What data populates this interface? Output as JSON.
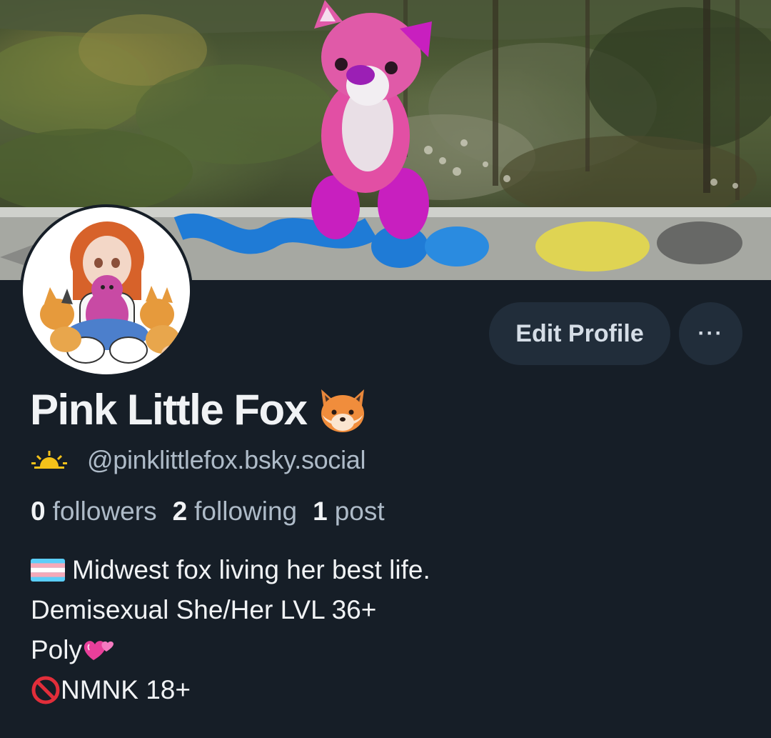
{
  "profile": {
    "display_name": "Pink Little Fox",
    "handle": "@pinklittlefox.bsky.social",
    "display_name_emoji": "fox-face-emoji",
    "handle_badge_icon": "sunrise-icon"
  },
  "actions": {
    "edit_profile_label": "Edit Profile",
    "more_label": "···"
  },
  "stats": {
    "followers_count": "0",
    "followers_label": "followers",
    "following_count": "2",
    "following_label": "following",
    "posts_count": "1",
    "posts_label": "post"
  },
  "bio": {
    "line1": "Midwest fox living her best life.",
    "line2": "Demisexual She/Her LVL 36+",
    "line3": "Poly",
    "line4": "NMNK 18+",
    "line1_emoji": "transgender-flag-icon",
    "line3_emoji": "two-hearts-icon",
    "line4_emoji": "prohibited-icon"
  },
  "colors": {
    "background": "#161e27",
    "button_bg": "#212d3a",
    "text_primary": "#f1f3f5",
    "text_secondary": "#aebbc8"
  }
}
